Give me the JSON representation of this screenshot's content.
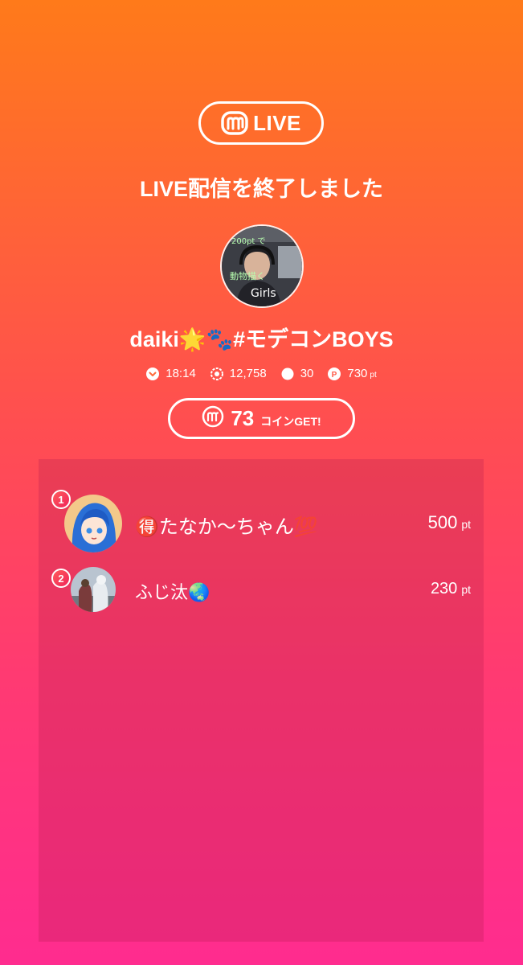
{
  "logo": {
    "text": "LIVE",
    "icon": "m-logo-icon"
  },
  "headline": "LIVE配信を終了しました",
  "streamer": {
    "name": "daiki🌟🐾#モデコンBOYS",
    "avatar_overlay_text": [
      "200pt で",
      "動物描く",
      "Girls"
    ]
  },
  "stats": {
    "duration": "18:14",
    "viewers": "12,758",
    "comments": "30",
    "points": "730",
    "points_unit": "pt"
  },
  "coins": {
    "amount": "73",
    "label": "コインGET!"
  },
  "ranking": [
    {
      "rank": "1",
      "name": "🉐たなか〜ちゃん💯",
      "points": "500",
      "unit": "pt"
    },
    {
      "rank": "2",
      "name": "ふじ汰🌏",
      "points": "230",
      "unit": "pt"
    }
  ],
  "colors": {
    "gradient_top": "#ff7a1a",
    "gradient_bottom": "#ff2c8f",
    "text": "#ffffff"
  }
}
